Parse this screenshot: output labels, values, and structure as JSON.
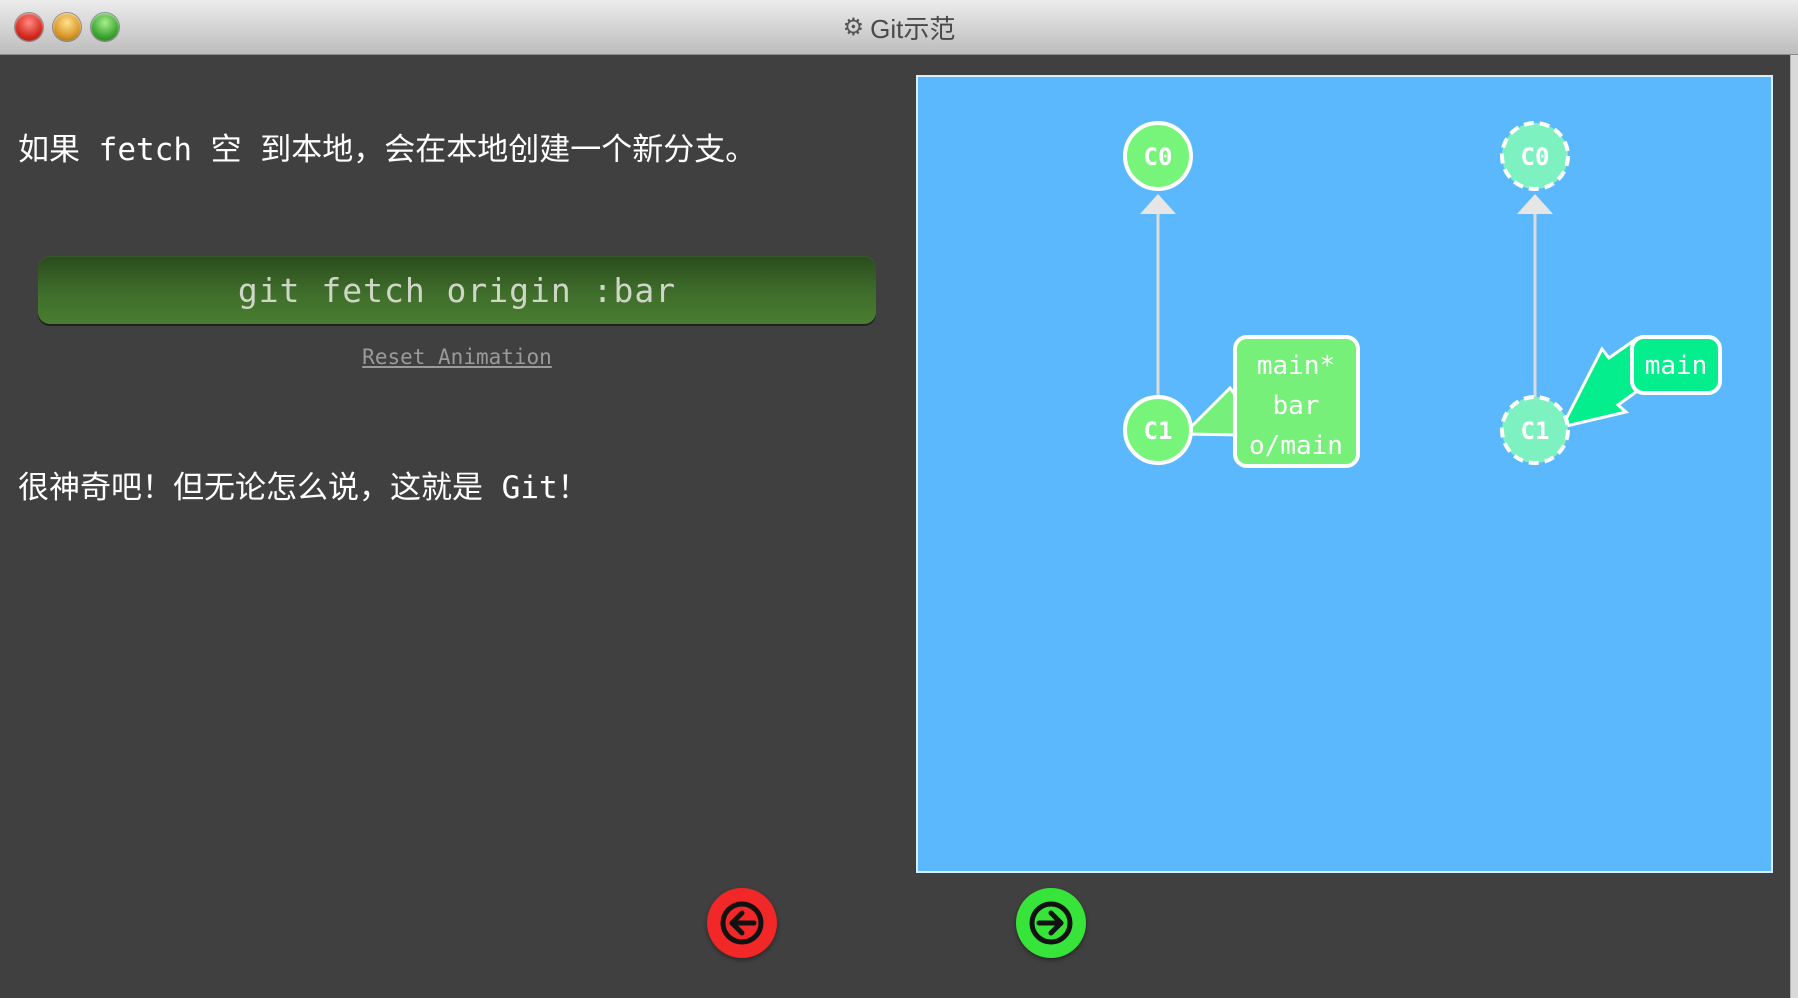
{
  "window": {
    "title": "Git示范",
    "icon": "gear-icon"
  },
  "content": {
    "paragraph_1": "如果 fetch 空 到本地，会在本地创建一个新分支。",
    "command": "git fetch origin :bar",
    "reset_label": "Reset Animation",
    "paragraph_2": "很神奇吧！但无论怎么说，这就是 Git！"
  },
  "graph": {
    "local": {
      "commits": [
        "C0",
        "C1"
      ],
      "branch_labels": [
        "main*",
        "bar",
        "o/main"
      ]
    },
    "remote": {
      "commits": [
        "C0",
        "C1"
      ],
      "branch_labels": [
        "main"
      ]
    }
  },
  "nav": {
    "prev_icon": "arrow-left-icon",
    "next_icon": "arrow-right-icon"
  },
  "colors": {
    "canvas_bg": "#5cb8fc",
    "commit_local": "#76f57a",
    "commit_remote": "#7df2c0",
    "branch_local": "#77f07a",
    "branch_remote": "#05ee8e",
    "prev_button": "#f22727",
    "next_button": "#37e43a"
  }
}
